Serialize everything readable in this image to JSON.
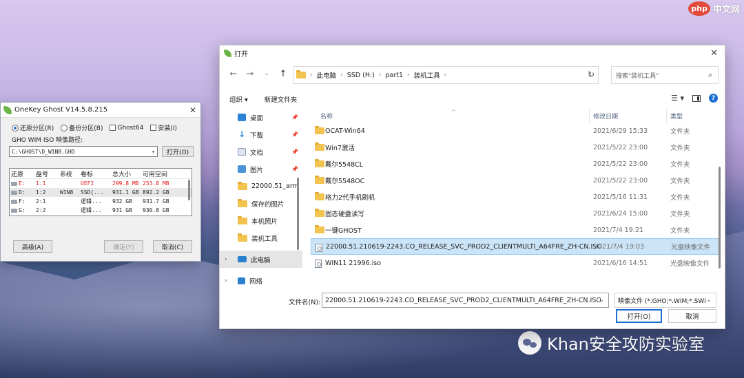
{
  "brand": {
    "php": "php",
    "text": "中文网"
  },
  "watermark": "Khan安全攻防实验室",
  "ghost": {
    "title": "OneKey Ghost V14.5.8.215",
    "options": {
      "restore": "还原分区(R)",
      "backup": "备份分区(B)",
      "ghost64": "Ghost64",
      "install": "安装(I)"
    },
    "path_label": "GHO WIM ISO 映像路径:",
    "path_value": "C:\\GHOST\\D_WIN8.GHD",
    "open_button": "打开(O)",
    "columns": [
      "还原",
      "盘号",
      "系统",
      "卷标",
      "总大小",
      "可用空间"
    ],
    "rows": [
      {
        "drive": "E:",
        "num": "1:1",
        "sys": "",
        "label": "UEFI",
        "total": "299.8 MB",
        "free": "253.8 MB"
      },
      {
        "drive": "D:",
        "num": "1:2",
        "sys": "WIN8",
        "label": "SSD(...",
        "total": "931.1 GB",
        "free": "892.2 GB"
      },
      {
        "drive": "F:",
        "num": "2:1",
        "sys": "",
        "label": "逻辑...",
        "total": "932 GB",
        "free": "931.7 GB"
      },
      {
        "drive": "G:",
        "num": "2:2",
        "sys": "",
        "label": "逻辑...",
        "total": "931 GB",
        "free": "930.8 GB"
      }
    ],
    "advanced_button": "高级(A)",
    "ok_button": "确定(Y)",
    "cancel_button": "取消(C)"
  },
  "dialog": {
    "title": "打开",
    "breadcrumb": [
      "此电脑",
      "SSD (H:)",
      "part1",
      "装机工具"
    ],
    "search_placeholder": "搜索\"装机工具\"",
    "toolbar": {
      "organize": "组织 ▾",
      "new_folder": "新建文件夹"
    },
    "sidebar": [
      {
        "label": "桌面",
        "icon": "desktop-icon",
        "pinned": true
      },
      {
        "label": "下载",
        "icon": "download-icon",
        "pinned": true
      },
      {
        "label": "文档",
        "icon": "document-icon",
        "pinned": true
      },
      {
        "label": "图片",
        "icon": "pictures-icon",
        "pinned": true
      },
      {
        "label": "22000.51_arm",
        "icon": "folder-icon",
        "pinned": false
      },
      {
        "label": "保存的图片",
        "icon": "folder-icon",
        "pinned": false
      },
      {
        "label": "本机照片",
        "icon": "folder-icon",
        "pinned": false
      },
      {
        "label": "装机工具",
        "icon": "folder-icon",
        "pinned": false
      },
      {
        "label": "此电脑",
        "icon": "this-pc-icon",
        "pinned": false
      },
      {
        "label": "网络",
        "icon": "network-icon",
        "pinned": false
      }
    ],
    "columns": {
      "name": "名称",
      "date": "修改日期",
      "type": "类型"
    },
    "files": [
      {
        "name": "OCAT-Win64",
        "date": "2021/6/29 15:33",
        "type": "文件夹",
        "kind": "folder"
      },
      {
        "name": "Win7激活",
        "date": "2021/5/22 23:00",
        "type": "文件夹",
        "kind": "folder"
      },
      {
        "name": "戴尔5548CL",
        "date": "2021/5/22 23:00",
        "type": "文件夹",
        "kind": "folder"
      },
      {
        "name": "戴尔5548OC",
        "date": "2021/5/22 23:00",
        "type": "文件夹",
        "kind": "folder"
      },
      {
        "name": "格力2代手机刷机",
        "date": "2021/5/16 11:31",
        "type": "文件夹",
        "kind": "folder"
      },
      {
        "name": "固态硬盘读写",
        "date": "2021/6/24 15:00",
        "type": "文件夹",
        "kind": "folder"
      },
      {
        "name": "一键GHOST",
        "date": "2021/7/4 19:21",
        "type": "文件夹",
        "kind": "folder"
      },
      {
        "name": "22000.51.210619-2243.CO_RELEASE_SVC_PROD2_CLIENTMULTI_A64FRE_ZH-CN.ISO",
        "date": "2021/7/4 19:03",
        "type": "光盘映像文件",
        "kind": "iso"
      },
      {
        "name": "WIN11 21996.iso",
        "date": "2021/6/16 14:51",
        "type": "光盘映像文件",
        "kind": "iso"
      }
    ],
    "filename_label": "文件名(N):",
    "filename_value": "22000.51.210619-2243.CO_RELEASE_SVC_PROD2_CLIENTMULTI_A64FRE_ZH-CN.ISO",
    "filetype_value": "映像文件 (*.GHO;*.WIM;*.SWI",
    "open_button": "打开(O)",
    "cancel_button": "取消"
  }
}
